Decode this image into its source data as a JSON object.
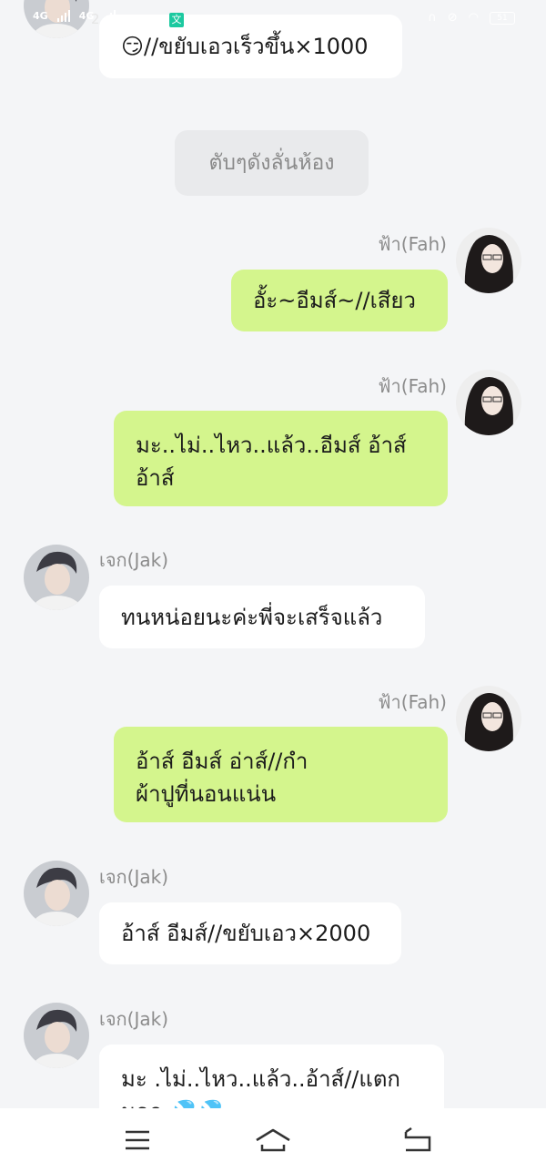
{
  "status_bar": {
    "network_1": "4G",
    "network_2": "4G",
    "time": "2",
    "battery": "51"
  },
  "messages": [
    {
      "side": "left",
      "text": "😏//ขยับเอวเร็วขึ้น×1000"
    },
    {
      "side": "system",
      "text": "ตับๆดังลั่นห้อง"
    },
    {
      "side": "right",
      "sender": "ฟ้า(Fah)",
      "text": "อั้ะ~อีมส์~//เสียว"
    },
    {
      "side": "right",
      "sender": "ฟ้า(Fah)",
      "line1": "มะ..ไม่..ไหว..แล้ว..อีมส์ อ้าส์",
      "line2": "อ้าส์"
    },
    {
      "side": "left",
      "sender": "เจก(Jak)",
      "text": "ทนหน่อยนะค่ะพี่จะเสร็จแล้ว"
    },
    {
      "side": "right",
      "sender": "ฟ้า(Fah)",
      "line1": "อ้าส์ อีมส์ อ่าส์//กำ",
      "line2": "ผ้าปูที่นอนแน่น"
    },
    {
      "side": "left",
      "sender": "เจก(Jak)",
      "text": "อ้าส์ อีมส์//ขยับเอว×2000"
    },
    {
      "side": "left",
      "sender": "เจก(Jak)",
      "line1": "มะ .ไม่..ไหว..แล้ว..อ้าส์//แตก",
      "line2": "นอก 💦💦"
    }
  ],
  "nav": {
    "menu_icon": "menu-icon",
    "home_icon": "home-icon",
    "back_icon": "back-icon"
  },
  "colors": {
    "background": "#f4f5f7",
    "bubble_left": "#ffffff",
    "bubble_right": "#d4f58d",
    "system_bubble": "#e9eaec",
    "name_text": "#8c8c8c"
  }
}
